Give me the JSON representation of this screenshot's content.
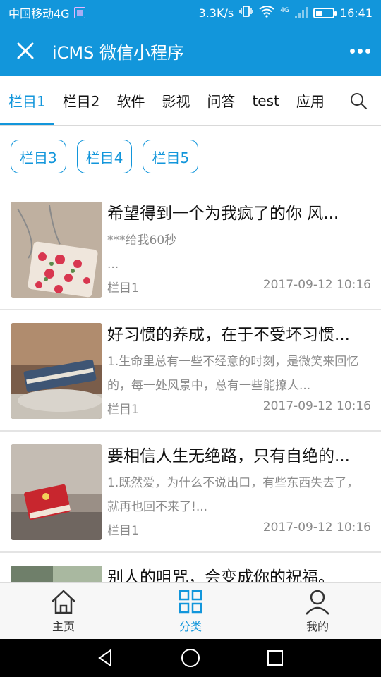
{
  "status": {
    "carrier": "中国移动4G",
    "speed": "3.3K/s",
    "network_type": "4G",
    "time": "16:41",
    "battery_level": 0.35
  },
  "titlebar": {
    "title": "iCMS 微信小程序"
  },
  "tabs": [
    {
      "label": "栏目1",
      "active": true
    },
    {
      "label": "栏目2"
    },
    {
      "label": "软件"
    },
    {
      "label": "影视"
    },
    {
      "label": "问答"
    },
    {
      "label": "test"
    },
    {
      "label": "应用"
    }
  ],
  "chips": [
    "栏目3",
    "栏目4",
    "栏目5"
  ],
  "articles": [
    {
      "title": "希望得到一个为我疯了的你 风...",
      "desc": "***给我60秒\n...",
      "category": "栏目1",
      "date": "2017-09-12 10:16"
    },
    {
      "title": "好习惯的养成，在于不受坏习惯...",
      "desc": "1.生命里总有一些不经意的时刻，是微笑来回忆的，每一处风景中，总有一些能撩人...",
      "category": "栏目1",
      "date": "2017-09-12 10:16"
    },
    {
      "title": "要相信人生无绝路，只有自绝的...",
      "desc": "1.既然爱，为什么不说出口，有些东西失去了，就再也回不来了!...",
      "category": "栏目1",
      "date": "2017-09-12 10:16"
    },
    {
      "title": "别人的咀咒，会变成你的祝福。",
      "desc": "",
      "category": "",
      "date": ""
    }
  ],
  "bottom_nav": [
    {
      "label": "主页",
      "icon": "home-icon"
    },
    {
      "label": "分类",
      "icon": "grid-icon",
      "active": true
    },
    {
      "label": "我的",
      "icon": "user-icon"
    }
  ],
  "colors": {
    "primary": "#1296db",
    "text": "#111111",
    "muted": "#8a8a8a"
  }
}
